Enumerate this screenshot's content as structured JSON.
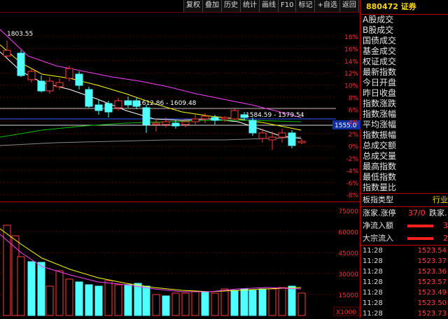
{
  "toolbar": {
    "buttons": [
      "复权",
      "叠加",
      "历史",
      "统计",
      "画线",
      "F10",
      "标记",
      "+自选",
      "返回"
    ]
  },
  "security": {
    "code": "880472",
    "name": "证券"
  },
  "main_chart": {
    "high_marker": "1803.55",
    "annotation_left": "1612.86 - 1609.48",
    "annotation_right": "1584.59 - 1579.54",
    "current_price_tag": "1555.0",
    "y_axis_labels": [
      "18%",
      "16%",
      "14%",
      "12%",
      "10%",
      "8%",
      "6%",
      "4%",
      "2%",
      "0%",
      "-2%",
      "-4%",
      "-6%",
      "-8%"
    ]
  },
  "volume_chart": {
    "y_axis_labels": [
      "75000",
      "60000",
      "45000",
      "30000",
      "15000"
    ],
    "unit_label": "X1000"
  },
  "right_panel": {
    "items": [
      "A股成交",
      "B股成交",
      "国债成交",
      "基金成交",
      "权证成交",
      "最新指数",
      "今日开盘",
      "昨日收盘",
      "指数涨跌",
      "指数涨幅",
      "平均涨幅",
      "指数振幅",
      "总成交额",
      "总成交量",
      "最高指数",
      "最低指数",
      "指数量比"
    ],
    "index_type_label": "板指类型",
    "index_type_value": "行业",
    "up_down_label": "涨家.涨停",
    "up_down_value": "37/0",
    "fall_label": "跌家.",
    "inflow_label": "净流入额",
    "block_label": "大宗流入",
    "inflow_digit": "3",
    "block_digit": "2",
    "ticks": [
      {
        "time": "11:28",
        "price": "1523.54"
      },
      {
        "time": "11:28",
        "price": "1523.37"
      },
      {
        "time": "11:28",
        "price": "1523.36"
      },
      {
        "time": "11:28",
        "price": "1523.57"
      },
      {
        "time": "11:28",
        "price": "1523.49"
      },
      {
        "time": "11:28",
        "price": "1523.50"
      },
      {
        "time": "11:28",
        "price": "1523.73"
      }
    ]
  },
  "colors": {
    "up": "#ff3b3b",
    "down": "#50ffff",
    "ma5": "#ffffff",
    "ma10": "#ffff00",
    "ma20": "#ff40ff",
    "ma60": "#00c000",
    "accent": "#ffd800",
    "frame": "#c00000"
  }
}
